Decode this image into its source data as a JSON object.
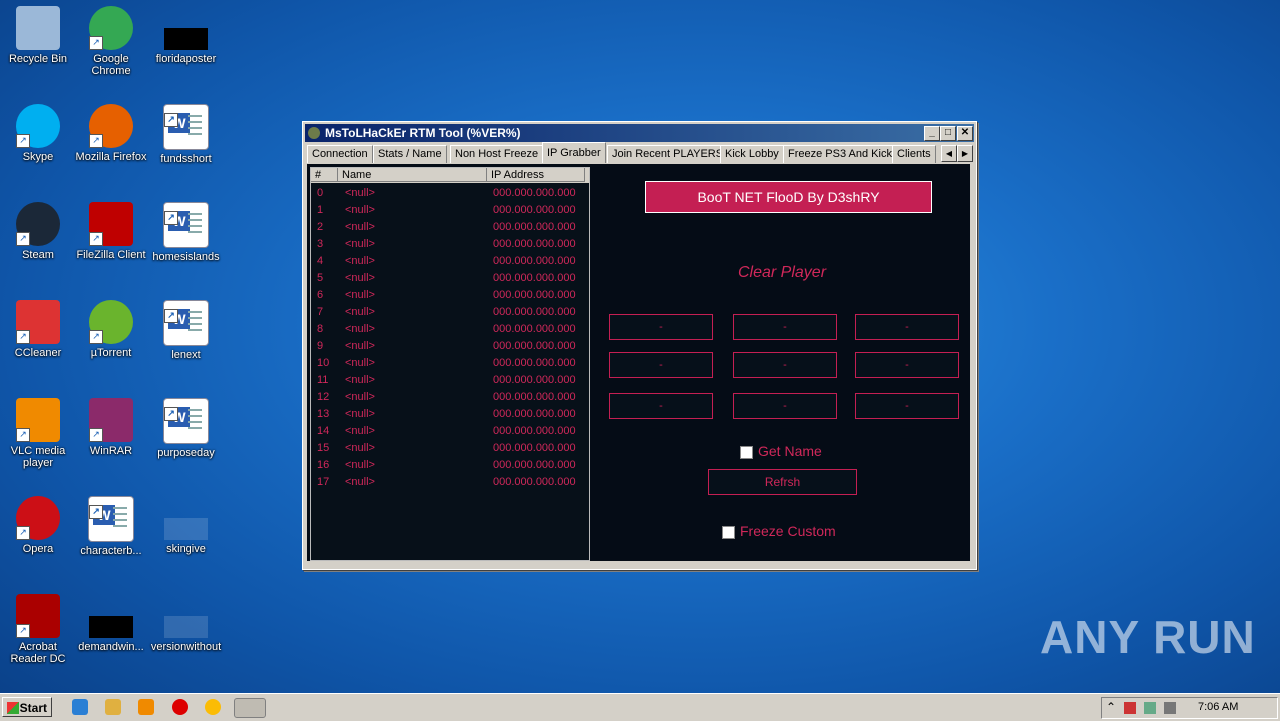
{
  "desktop": {
    "icons": [
      {
        "label": "Recycle Bin",
        "icon": "recycle-bin-icon"
      },
      {
        "label": "Google Chrome",
        "icon": "chrome-icon"
      },
      {
        "label": "floridaposter",
        "icon": "black-file-icon"
      },
      {
        "label": "Skype",
        "icon": "skype-icon"
      },
      {
        "label": "Mozilla Firefox",
        "icon": "firefox-icon"
      },
      {
        "label": "fundsshort",
        "icon": "word-doc-icon"
      },
      {
        "label": "Steam",
        "icon": "steam-icon"
      },
      {
        "label": "FileZilla Client",
        "icon": "filezilla-icon"
      },
      {
        "label": "homesislands",
        "icon": "word-doc-icon"
      },
      {
        "label": "CCleaner",
        "icon": "ccleaner-icon"
      },
      {
        "label": "µTorrent",
        "icon": "utorrent-icon"
      },
      {
        "label": "lenext",
        "icon": "word-doc-icon"
      },
      {
        "label": "VLC media player",
        "icon": "vlc-icon"
      },
      {
        "label": "WinRAR",
        "icon": "winrar-icon"
      },
      {
        "label": "purposeday",
        "icon": "word-doc-icon"
      },
      {
        "label": "Opera",
        "icon": "opera-icon"
      },
      {
        "label": "characterb...",
        "icon": "word-doc-icon"
      },
      {
        "label": "skingive",
        "icon": "blank-file-icon"
      },
      {
        "label": "Acrobat Reader DC",
        "icon": "acrobat-icon"
      },
      {
        "label": "demandwin...",
        "icon": "black-file-icon"
      },
      {
        "label": "versionwithout",
        "icon": "blank-file-icon"
      }
    ]
  },
  "window": {
    "title": "MsToLHaCkEr RTM Tool (%VER%)",
    "min": "_",
    "max": "□",
    "close": "✕",
    "tabs": [
      "Connection",
      "Stats / Name",
      "Non Host Freeze",
      "IP Grabber",
      "Join Recent PLAYERS",
      "Kick Lobby",
      "Freeze PS3 And Kick",
      "Clients"
    ],
    "active_tab": "IP Grabber",
    "tab_left": "◀",
    "tab_right": "▶"
  },
  "list": {
    "headers": [
      "#",
      "Name",
      "IP Address"
    ],
    "rows": [
      [
        "0",
        "<null>",
        "000.000.000.000"
      ],
      [
        "1",
        "<null>",
        "000.000.000.000"
      ],
      [
        "2",
        "<null>",
        "000.000.000.000"
      ],
      [
        "3",
        "<null>",
        "000.000.000.000"
      ],
      [
        "4",
        "<null>",
        "000.000.000.000"
      ],
      [
        "5",
        "<null>",
        "000.000.000.000"
      ],
      [
        "6",
        "<null>",
        "000.000.000.000"
      ],
      [
        "7",
        "<null>",
        "000.000.000.000"
      ],
      [
        "8",
        "<null>",
        "000.000.000.000"
      ],
      [
        "9",
        "<null>",
        "000.000.000.000"
      ],
      [
        "10",
        "<null>",
        "000.000.000.000"
      ],
      [
        "11",
        "<null>",
        "000.000.000.000"
      ],
      [
        "12",
        "<null>",
        "000.000.000.000"
      ],
      [
        "13",
        "<null>",
        "000.000.000.000"
      ],
      [
        "14",
        "<null>",
        "000.000.000.000"
      ],
      [
        "15",
        "<null>",
        "000.000.000.000"
      ],
      [
        "16",
        "<null>",
        "000.000.000.000"
      ],
      [
        "17",
        "<null>",
        "000.000.000.000"
      ]
    ]
  },
  "controls": {
    "boot_button": "BooT NET FlooD By D3shRY",
    "clear_label": "Clear Player",
    "fields": [
      "-",
      "-",
      "-",
      "-",
      "-",
      "-",
      "-",
      "-",
      "-"
    ],
    "get_name": "Get Name",
    "refresh": "Refrsh",
    "freeze_custom": "Freeze Custom"
  },
  "taskbar": {
    "start": "Start",
    "tray_up": "⌃",
    "clock": "7:06 AM"
  },
  "watermark": "ANY RUN",
  "colors": {
    "accent": "#c41f53",
    "text_red": "#d0285a",
    "panel": "#050c16"
  }
}
